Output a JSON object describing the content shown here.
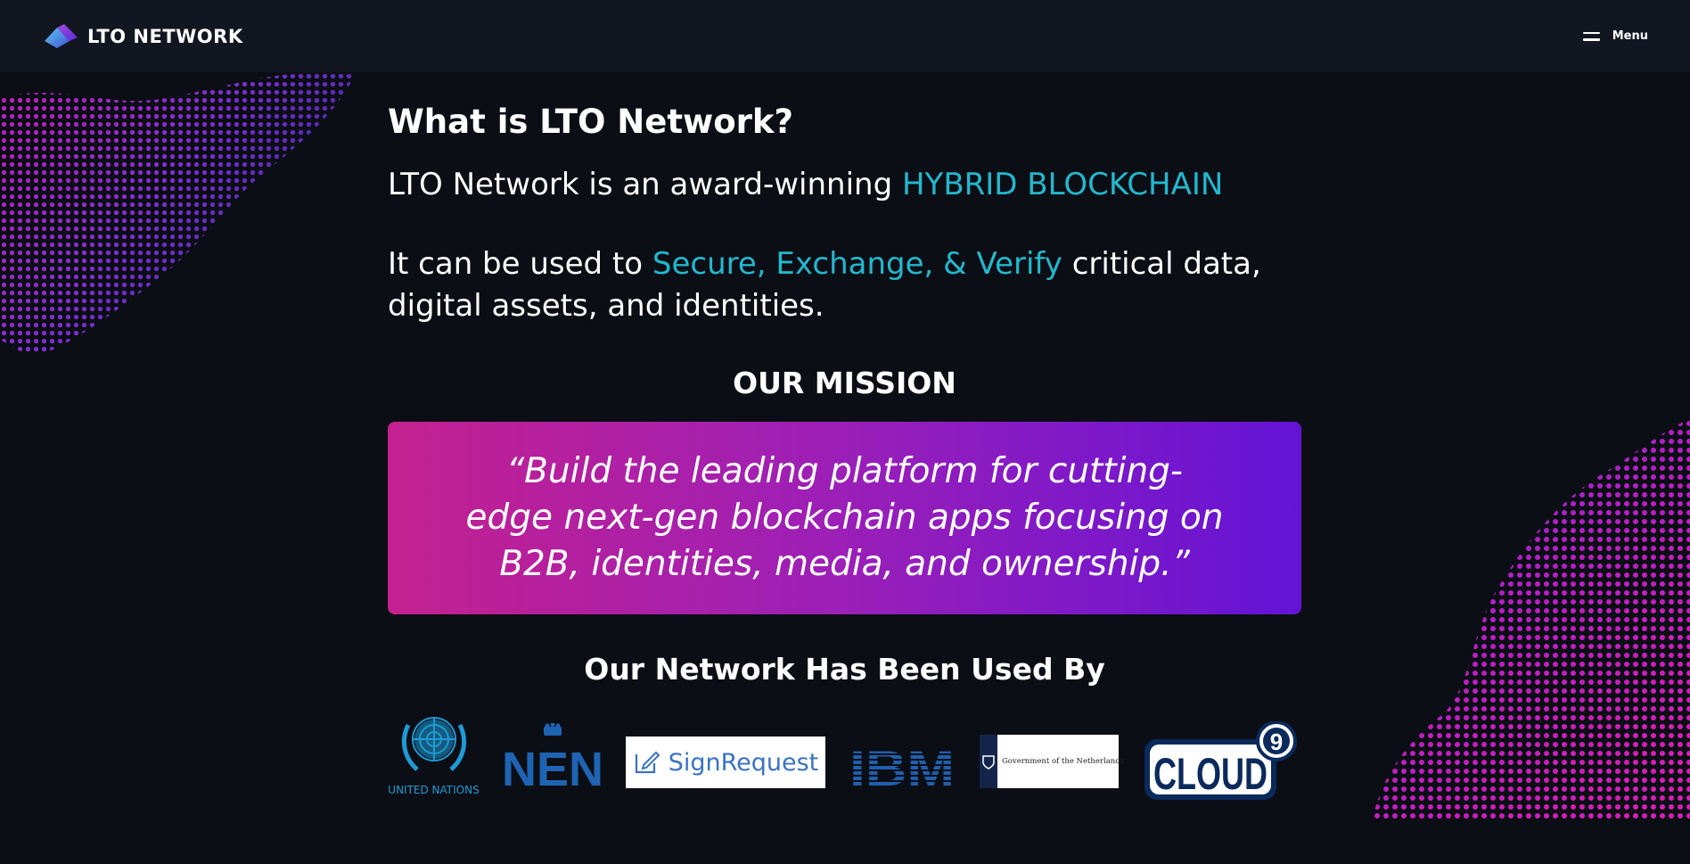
{
  "nav": {
    "brand": "LTO NETWORK",
    "menu_label": "Menu"
  },
  "intro": {
    "heading": "What is LTO Network?",
    "line1_prefix": "LTO Network is an award-winning ",
    "line1_highlight": "HYBRID BLOCKCHAIN",
    "line2_prefix": "It can be used to ",
    "line2_highlight": "Secure, Exchange, & Verify",
    "line2_suffix": " critical data, digital assets, and identities."
  },
  "mission": {
    "title": "OUR MISSION",
    "quote": "“Build the leading platform for cutting-edge next-gen blockchain apps focusing on B2B, identities, media, and ownership.”"
  },
  "used_by": {
    "title": "Our Network Has Been Used By",
    "logos": [
      {
        "name": "United Nations",
        "text": "UNITED NATIONS"
      },
      {
        "name": "NEN",
        "text": "NEN"
      },
      {
        "name": "SignRequest",
        "text": "SignRequest"
      },
      {
        "name": "IBM",
        "text": "IBM"
      },
      {
        "name": "Government of the Netherlands",
        "text": "Government of the Netherlands"
      },
      {
        "name": "Cloud9",
        "text": "CLOUD",
        "badge": "9"
      }
    ]
  },
  "colors": {
    "accent": "#22b8cf",
    "nav_bg": "#121620",
    "page_bg": "#0b0e14",
    "mission_gradient_start": "#c4218f",
    "mission_gradient_end": "#6413d6",
    "un_blue": "#1e9bd7",
    "nen_blue": "#1f64b4",
    "ibm_blue": "#1f5fae",
    "cloud9_navy": "#0b2a5c"
  }
}
